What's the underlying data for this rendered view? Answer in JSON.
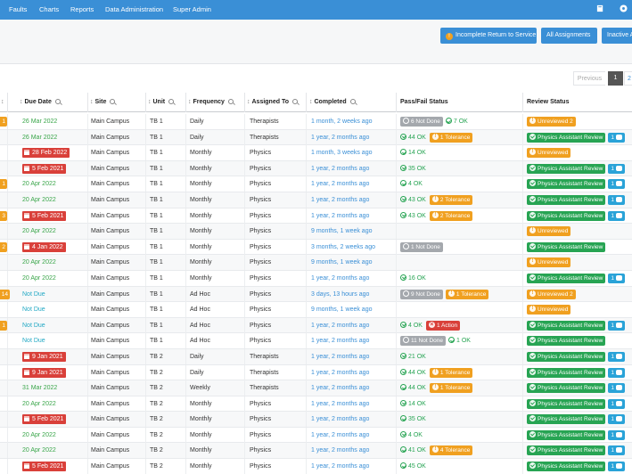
{
  "nav": {
    "items": [
      "Faults",
      "Charts",
      "Reports",
      "Data Administration",
      "Super Admin"
    ],
    "icons": [
      "book-icon",
      "settings-icon"
    ]
  },
  "toolbar": {
    "incomplete_label": "Incomplete Return to Service",
    "all_assignments_label": "All Assignments",
    "inactive_label": "Inactive A"
  },
  "pager": {
    "prev": "Previous",
    "current": "1",
    "next": "2"
  },
  "table": {
    "headers": {
      "due": "Due Date",
      "site": "Site",
      "unit": "Unit",
      "freq": "Frequency",
      "assigned": "Assigned To",
      "completed": "Completed",
      "passfail": "Pass/Fail Status",
      "review": "Review Status"
    },
    "rows": [
      {
        "left": "1",
        "due": "26 Mar 2022",
        "due_style": "green",
        "site": "Main Campus",
        "unit": "TB 1",
        "freq": "Daily",
        "assigned": "Therapists",
        "completed": "1 month, 2 weeks ago",
        "pf": [
          {
            "t": "tag",
            "c": "grey",
            "icon": "grey",
            "v": "6 Not Done"
          },
          {
            "t": "ok",
            "v": "7 OK"
          }
        ],
        "rev": {
          "c": "orange",
          "v": "Unreviewed 2"
        }
      },
      {
        "left": "",
        "due": "26 Mar 2022",
        "due_style": "green",
        "site": "Main Campus",
        "unit": "TB 1",
        "freq": "Daily",
        "assigned": "Therapists",
        "completed": "1 year, 2 months ago",
        "pf": [
          {
            "t": "ok",
            "v": "44 OK"
          },
          {
            "t": "tag",
            "c": "orange",
            "icon": "orange",
            "v": "1 Tolerance"
          }
        ],
        "rev": {
          "c": "green",
          "v": "Physics Assistant Review",
          "count": "1"
        }
      },
      {
        "left": "",
        "due": "28 Feb 2022",
        "due_style": "red",
        "site": "Main Campus",
        "unit": "TB 1",
        "freq": "Monthly",
        "assigned": "Physics",
        "completed": "1 month, 3 weeks ago",
        "pf": [
          {
            "t": "ok",
            "v": "14 OK"
          }
        ],
        "rev": {
          "c": "orange",
          "v": "Unreviewed"
        }
      },
      {
        "left": "",
        "due": "5 Feb 2021",
        "due_style": "red",
        "site": "Main Campus",
        "unit": "TB 1",
        "freq": "Monthly",
        "assigned": "Physics",
        "completed": "1 year, 2 months ago",
        "pf": [
          {
            "t": "ok",
            "v": "35 OK"
          }
        ],
        "rev": {
          "c": "green",
          "v": "Physics Assistant Review",
          "count": "1"
        }
      },
      {
        "left": "1",
        "due": "20 Apr 2022",
        "due_style": "green",
        "site": "Main Campus",
        "unit": "TB 1",
        "freq": "Monthly",
        "assigned": "Physics",
        "completed": "1 year, 2 months ago",
        "pf": [
          {
            "t": "ok",
            "v": "4 OK"
          }
        ],
        "rev": {
          "c": "green",
          "v": "Physics Assistant Review",
          "count": "1"
        }
      },
      {
        "left": "",
        "due": "20 Apr 2022",
        "due_style": "green",
        "site": "Main Campus",
        "unit": "TB 1",
        "freq": "Monthly",
        "assigned": "Physics",
        "completed": "1 year, 2 months ago",
        "pf": [
          {
            "t": "ok",
            "v": "43 OK"
          },
          {
            "t": "tag",
            "c": "orange",
            "icon": "orange",
            "v": "2 Tolerance"
          }
        ],
        "rev": {
          "c": "green",
          "v": "Physics Assistant Review",
          "count": "1"
        }
      },
      {
        "left": "3",
        "due": "5 Feb 2021",
        "due_style": "red",
        "site": "Main Campus",
        "unit": "TB 1",
        "freq": "Monthly",
        "assigned": "Physics",
        "completed": "1 year, 2 months ago",
        "pf": [
          {
            "t": "ok",
            "v": "43 OK"
          },
          {
            "t": "tag",
            "c": "orange",
            "icon": "orange",
            "v": "2 Tolerance"
          }
        ],
        "rev": {
          "c": "green",
          "v": "Physics Assistant Review",
          "count": "1"
        }
      },
      {
        "left": "",
        "due": "20 Apr 2022",
        "due_style": "green",
        "site": "Main Campus",
        "unit": "TB 1",
        "freq": "Monthly",
        "assigned": "Physics",
        "completed": "9 months, 1 week ago",
        "pf": [],
        "rev": {
          "c": "orange",
          "v": "Unreviewed"
        }
      },
      {
        "left": "2",
        "due": "4 Jan 2022",
        "due_style": "red",
        "site": "Main Campus",
        "unit": "TB 1",
        "freq": "Monthly",
        "assigned": "Physics",
        "completed": "3 months, 2 weeks ago",
        "pf": [
          {
            "t": "tag",
            "c": "grey",
            "icon": "grey",
            "v": "1 Not Done"
          }
        ],
        "rev": {
          "c": "green",
          "v": "Physics Assistant Review"
        }
      },
      {
        "left": "",
        "due": "20 Apr 2022",
        "due_style": "green",
        "site": "Main Campus",
        "unit": "TB 1",
        "freq": "Monthly",
        "assigned": "Physics",
        "completed": "9 months, 1 week ago",
        "pf": [],
        "rev": {
          "c": "orange",
          "v": "Unreviewed"
        }
      },
      {
        "left": "",
        "due": "20 Apr 2022",
        "due_style": "green",
        "site": "Main Campus",
        "unit": "TB 1",
        "freq": "Monthly",
        "assigned": "Physics",
        "completed": "1 year, 2 months ago",
        "pf": [
          {
            "t": "ok",
            "v": "16 OK"
          }
        ],
        "rev": {
          "c": "green",
          "v": "Physics Assistant Review",
          "count": "1"
        }
      },
      {
        "left": "14",
        "due": "Not Due",
        "due_style": "teal",
        "site": "Main Campus",
        "unit": "TB 1",
        "freq": "Ad Hoc",
        "assigned": "Physics",
        "completed": "3 days, 13 hours ago",
        "pf": [
          {
            "t": "tag",
            "c": "grey",
            "icon": "grey",
            "v": "9 Not Done"
          },
          {
            "t": "tag",
            "c": "orange",
            "icon": "orange",
            "v": "1 Tolerance"
          }
        ],
        "rev": {
          "c": "orange",
          "v": "Unreviewed 2"
        }
      },
      {
        "left": "",
        "due": "Not Due",
        "due_style": "teal",
        "site": "Main Campus",
        "unit": "TB 1",
        "freq": "Ad Hoc",
        "assigned": "Physics",
        "completed": "9 months, 1 week ago",
        "pf": [],
        "rev": {
          "c": "orange",
          "v": "Unreviewed"
        }
      },
      {
        "left": "1",
        "due": "Not Due",
        "due_style": "teal",
        "site": "Main Campus",
        "unit": "TB 1",
        "freq": "Ad Hoc",
        "assigned": "Physics",
        "completed": "1 year, 2 months ago",
        "pf": [
          {
            "t": "ok",
            "v": "4 OK"
          },
          {
            "t": "tag",
            "c": "red",
            "icon": "red",
            "v": "1 Action"
          }
        ],
        "rev": {
          "c": "green",
          "v": "Physics Assistant Review",
          "count": "1"
        }
      },
      {
        "left": "",
        "due": "Not Due",
        "due_style": "teal",
        "site": "Main Campus",
        "unit": "TB 1",
        "freq": "Ad Hoc",
        "assigned": "Physics",
        "completed": "1 year, 2 months ago",
        "pf": [
          {
            "t": "tag",
            "c": "grey",
            "icon": "grey",
            "v": "11 Not Done"
          },
          {
            "t": "ok",
            "v": "1 OK"
          }
        ],
        "rev": {
          "c": "green",
          "v": "Physics Assistant Review"
        }
      },
      {
        "left": "",
        "due": "9 Jan 2021",
        "due_style": "red",
        "site": "Main Campus",
        "unit": "TB 2",
        "freq": "Daily",
        "assigned": "Therapists",
        "completed": "1 year, 2 months ago",
        "pf": [
          {
            "t": "ok",
            "v": "21 OK"
          }
        ],
        "rev": {
          "c": "green",
          "v": "Physics Assistant Review",
          "count": "1"
        }
      },
      {
        "left": "",
        "due": "9 Jan 2021",
        "due_style": "red",
        "site": "Main Campus",
        "unit": "TB 2",
        "freq": "Daily",
        "assigned": "Therapists",
        "completed": "1 year, 2 months ago",
        "pf": [
          {
            "t": "ok",
            "v": "44 OK"
          },
          {
            "t": "tag",
            "c": "orange",
            "icon": "orange",
            "v": "1 Tolerance"
          }
        ],
        "rev": {
          "c": "green",
          "v": "Physics Assistant Review",
          "count": "1"
        }
      },
      {
        "left": "",
        "due": "31 Mar 2022",
        "due_style": "green",
        "site": "Main Campus",
        "unit": "TB 2",
        "freq": "Weekly",
        "assigned": "Therapists",
        "completed": "1 year, 2 months ago",
        "pf": [
          {
            "t": "ok",
            "v": "44 OK"
          },
          {
            "t": "tag",
            "c": "orange",
            "icon": "orange",
            "v": "1 Tolerance"
          }
        ],
        "rev": {
          "c": "green",
          "v": "Physics Assistant Review",
          "count": "1"
        }
      },
      {
        "left": "",
        "due": "20 Apr 2022",
        "due_style": "green",
        "site": "Main Campus",
        "unit": "TB 2",
        "freq": "Monthly",
        "assigned": "Physics",
        "completed": "1 year, 2 months ago",
        "pf": [
          {
            "t": "ok",
            "v": "14 OK"
          }
        ],
        "rev": {
          "c": "green",
          "v": "Physics Assistant Review",
          "count": "1"
        }
      },
      {
        "left": "",
        "due": "5 Feb 2021",
        "due_style": "red",
        "site": "Main Campus",
        "unit": "TB 2",
        "freq": "Monthly",
        "assigned": "Physics",
        "completed": "1 year, 2 months ago",
        "pf": [
          {
            "t": "ok",
            "v": "35 OK"
          }
        ],
        "rev": {
          "c": "green",
          "v": "Physics Assistant Review",
          "count": "1"
        }
      },
      {
        "left": "",
        "due": "20 Apr 2022",
        "due_style": "green",
        "site": "Main Campus",
        "unit": "TB 2",
        "freq": "Monthly",
        "assigned": "Physics",
        "completed": "1 year, 2 months ago",
        "pf": [
          {
            "t": "ok",
            "v": "4 OK"
          }
        ],
        "rev": {
          "c": "green",
          "v": "Physics Assistant Review",
          "count": "1"
        }
      },
      {
        "left": "",
        "due": "20 Apr 2022",
        "due_style": "green",
        "site": "Main Campus",
        "unit": "TB 2",
        "freq": "Monthly",
        "assigned": "Physics",
        "completed": "1 year, 2 months ago",
        "pf": [
          {
            "t": "ok",
            "v": "41 OK"
          },
          {
            "t": "tag",
            "c": "orange",
            "icon": "orange",
            "v": "4 Tolerance"
          }
        ],
        "rev": {
          "c": "green",
          "v": "Physics Assistant Review",
          "count": "1"
        }
      },
      {
        "left": "",
        "due": "5 Feb 2021",
        "due_style": "red",
        "site": "Main Campus",
        "unit": "TB 2",
        "freq": "Monthly",
        "assigned": "Physics",
        "completed": "1 year, 2 months ago",
        "pf": [
          {
            "t": "ok",
            "v": "45 OK"
          }
        ],
        "rev": {
          "c": "green",
          "v": "Physics Assistant Review",
          "count": "1"
        }
      }
    ]
  }
}
